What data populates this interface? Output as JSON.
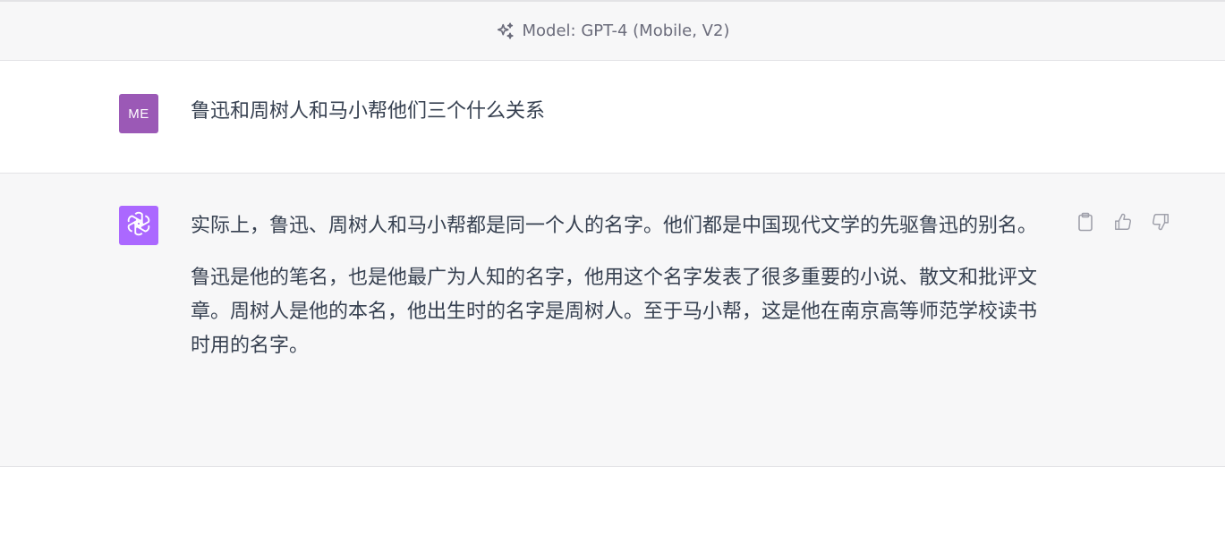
{
  "header": {
    "model_label": "Model: GPT-4 (Mobile, V2)",
    "icon": "sparkles-icon"
  },
  "conversation": {
    "user": {
      "avatar_initials": "ME",
      "avatar_color": "#9b59b6",
      "message": "鲁迅和周树人和马小帮他们三个什么关系"
    },
    "assistant": {
      "avatar_icon": "openai-logo-icon",
      "avatar_color": "#ab68ff",
      "paragraphs": [
        "实际上，鲁迅、周树人和马小帮都是同一个人的名字。他们都是中国现代文学的先驱鲁迅的别名。",
        "鲁迅是他的笔名，也是他最广为人知的名字，他用这个名字发表了很多重要的小说、散文和批评文章。周树人是他的本名，他出生时的名字是周树人。至于马小帮，这是他在南京高等师范学校读书时用的名字。"
      ],
      "actions": [
        "clipboard-icon",
        "thumbs-up-icon",
        "thumbs-down-icon"
      ]
    }
  },
  "colors": {
    "header_bg": "#f7f7f8",
    "assistant_bg": "#f7f7f8",
    "text": "#374151",
    "muted": "#6b6c7b"
  }
}
